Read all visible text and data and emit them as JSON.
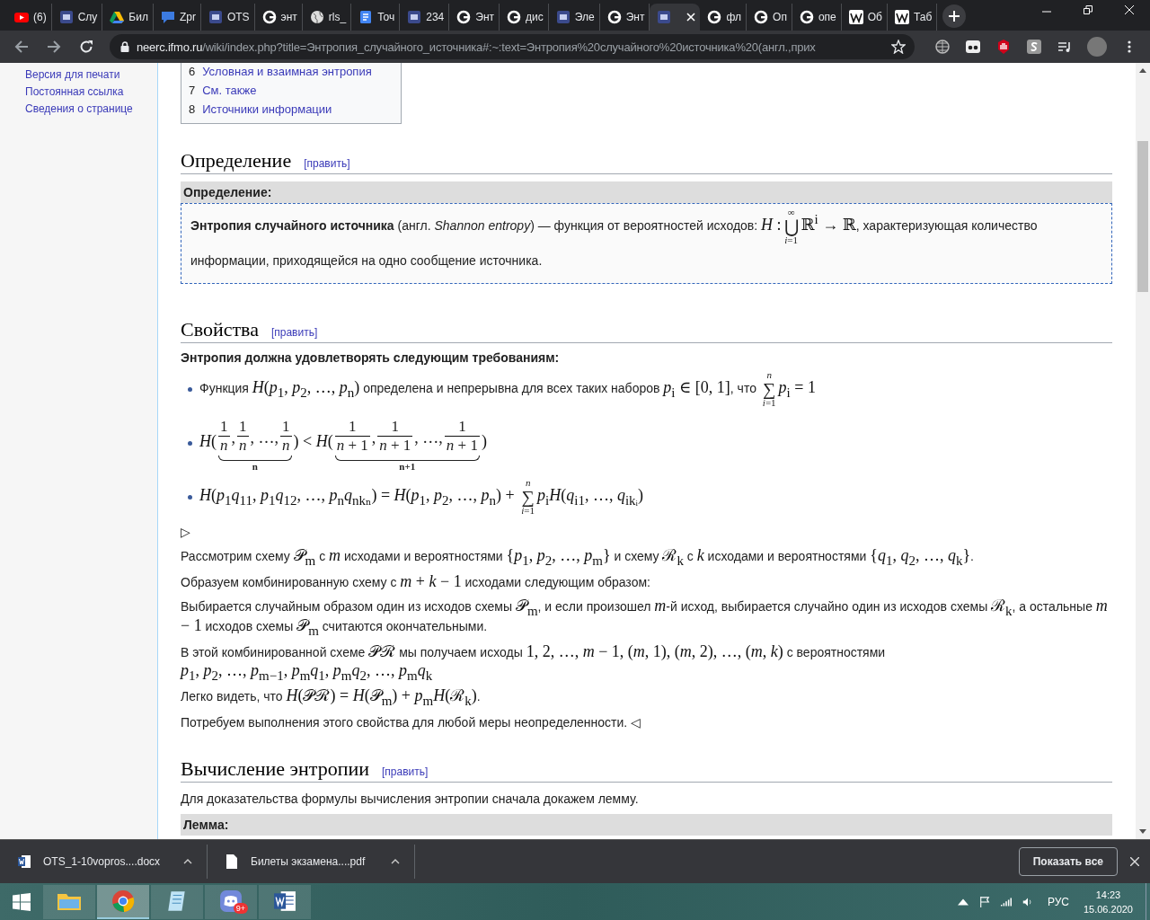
{
  "tabs": [
    {
      "kind": "video",
      "label": "(6)",
      "selected": false
    },
    {
      "kind": "square",
      "label": "Слу",
      "selected": false
    },
    {
      "kind": "drive",
      "label": "Бил",
      "selected": false
    },
    {
      "kind": "chat",
      "label": "Zpr",
      "selected": false
    },
    {
      "kind": "square",
      "label": "OTS",
      "selected": false
    },
    {
      "kind": "search",
      "label": "энт",
      "selected": false
    },
    {
      "kind": "globe",
      "label": "rls_",
      "selected": false
    },
    {
      "kind": "doc",
      "label": "Точ",
      "selected": false
    },
    {
      "kind": "square",
      "label": "234",
      "selected": false
    },
    {
      "kind": "search",
      "label": "Энт",
      "selected": false
    },
    {
      "kind": "search",
      "label": "дис",
      "selected": false
    },
    {
      "kind": "square",
      "label": "Эле",
      "selected": false
    },
    {
      "kind": "search",
      "label": "Энт",
      "selected": false
    },
    {
      "kind": "square",
      "selected": true
    },
    {
      "kind": "search",
      "label": "фл",
      "selected": false
    },
    {
      "kind": "search",
      "label": "Оп",
      "selected": false
    },
    {
      "kind": "search",
      "label": "опе",
      "selected": false
    },
    {
      "kind": "wiki",
      "label": "Об",
      "selected": false
    },
    {
      "kind": "wiki",
      "label": "Таб",
      "selected": false
    }
  ],
  "address": {
    "domain": "neerc.ifmo.ru",
    "path": "/wiki/index.php?title=Энтропия_случайного_источника#:~:text=Энтропия%20случайного%20источника%20(англ.,прих"
  },
  "sidebar": {
    "items": [
      "Версия для печати",
      "Постоянная ссылка",
      "Сведения о странице"
    ]
  },
  "toc": [
    {
      "number": "6",
      "label": "Условная и взаимная энтропия"
    },
    {
      "number": "7",
      "label": "См. также"
    },
    {
      "number": "8",
      "label": "Источники информации"
    }
  ],
  "sections": [
    {
      "title": "Определение",
      "edit": "[править]",
      "blocks": [
        {
          "kind": "boxhead",
          "text": "Определение:"
        },
        {
          "kind": "definition",
          "parts": [
            {
              "kind": "text",
              "text": "**Энтропия случайного источника** (англ. *Shannon entropy*) — функция от вероятностей исходов: "
            },
            {
              "kind": "math",
              "text": "*H* :"
            },
            {
              "kind": "bigop",
              "symbol": "⋃",
              "upper": "∞",
              "lower": "*i*=1"
            },
            {
              "kind": "math",
              "text": "ℝ$^{i}$ → ℝ"
            },
            {
              "kind": "text",
              "text": ", характеризующая количество информации, приходящейся на одно сообщение источника."
            }
          ]
        }
      ]
    },
    {
      "title": "Свойства",
      "edit": "[править]",
      "blocks": [
        {
          "kind": "lead",
          "text": "Энтропия должна удовлетворять следующим требованиям:"
        },
        {
          "kind": "bullets",
          "items": [
            {
              "parts": [
                {
                  "kind": "text",
                  "text": "Функция "
                },
                {
                  "kind": "math",
                  "text": "*H*(*p*$_{1}$, *p*$_{2}$, …, *p*$_{n}$)"
                },
                {
                  "kind": "text",
                  "text": " определена и непрерывна для всех таких наборов "
                },
                {
                  "kind": "math",
                  "text": "*p*$_{i}$ ∈ [0,  1]"
                },
                {
                  "kind": "text",
                  "text": ", что "
                },
                {
                  "kind": "bigop",
                  "symbol": "∑",
                  "upper": "*n*",
                  "lower": "*i*=1"
                },
                {
                  "kind": "math",
                  "text": "*p*$_{i}$ = 1"
                }
              ]
            },
            {
              "parts": [
                {
                  "kind": "math",
                  "text": "*H*("
                },
                {
                  "kind": "brace",
                  "label": "n",
                  "terms": [
                    {
                      "kind": "frac",
                      "num": "1",
                      "den": "*n*",
                      "sep": ","
                    },
                    {
                      "kind": "frac",
                      "num": "1",
                      "den": "*n*",
                      "sep": ", …,"
                    },
                    {
                      "kind": "frac",
                      "num": "1",
                      "den": "*n*"
                    }
                  ]
                },
                {
                  "kind": "math",
                  "text": ") < *H*("
                },
                {
                  "kind": "brace",
                  "label": "n+1",
                  "terms": [
                    {
                      "kind": "frac",
                      "num": "1",
                      "den": "*n* + 1",
                      "sep": ","
                    },
                    {
                      "kind": "frac",
                      "num": "1",
                      "den": "*n* + 1",
                      "sep": ", …,"
                    },
                    {
                      "kind": "frac",
                      "num": "1",
                      "den": "*n* + 1"
                    }
                  ]
                },
                {
                  "kind": "math",
                  "text": ")"
                }
              ]
            },
            {
              "parts": [
                {
                  "kind": "math",
                  "text": "*H*(*p*$_{1}$*q*$_{11}$, *p*$_{1}$*q*$_{12}$, …, *p*$_{n}$*q*$_{nkₙ}$) = *H*(*p*$_{1}$, *p*$_{2}$, …, *p*$_{n}$) + "
                },
                {
                  "kind": "bigop",
                  "symbol": "∑",
                  "upper": "*n*",
                  "lower": "*i*=1"
                },
                {
                  "kind": "math",
                  "text": "*p*$_{i}$*H*(*q*$_{i1}$, …, *q*$_{ikᵢ}$)"
                }
              ]
            }
          ]
        },
        {
          "kind": "para",
          "parts": [
            {
              "kind": "text",
              "text": "▷"
            }
          ]
        },
        {
          "kind": "para",
          "parts": [
            {
              "kind": "text",
              "text": "Рассмотрим схему "
            },
            {
              "kind": "math",
              "text": "𝒫$_{m}$"
            },
            {
              "kind": "text",
              "text": " с "
            },
            {
              "kind": "math",
              "text": "*m*"
            },
            {
              "kind": "text",
              "text": " исходами и вероятностями "
            },
            {
              "kind": "math",
              "text": "{*p*$_{1}$, *p*$_{2}$, …, *p*$_{m}$}"
            },
            {
              "kind": "text",
              "text": " и схему "
            },
            {
              "kind": "math",
              "text": "ℛ$_{k}$"
            },
            {
              "kind": "text",
              "text": " с "
            },
            {
              "kind": "math",
              "text": "*k*"
            },
            {
              "kind": "text",
              "text": " исходами и вероятностями "
            },
            {
              "kind": "math",
              "text": "{*q*$_{1}$, *q*$_{2}$, …, *q*$_{k}$}"
            },
            {
              "kind": "text",
              "text": "."
            }
          ]
        },
        {
          "kind": "para",
          "parts": [
            {
              "kind": "text",
              "text": "Образуем комбинированную схему с "
            },
            {
              "kind": "math",
              "text": "*m* + *k* − 1"
            },
            {
              "kind": "text",
              "text": " исходами следующим образом:"
            }
          ]
        },
        {
          "kind": "para",
          "parts": [
            {
              "kind": "text",
              "text": "Выбирается случайным образом один из исходов схемы "
            },
            {
              "kind": "math",
              "text": "𝒫$_{m}$"
            },
            {
              "kind": "text",
              "text": ", и если произошел "
            },
            {
              "kind": "math",
              "text": "*m*"
            },
            {
              "kind": "text",
              "text": "-й исход, выбирается случайно один из исходов схемы "
            },
            {
              "kind": "math",
              "text": "ℛ$_{k}$"
            },
            {
              "kind": "text",
              "text": ", а остальные "
            },
            {
              "kind": "math",
              "text": "*m* − 1"
            },
            {
              "kind": "text",
              "text": " исходов схемы "
            },
            {
              "kind": "math",
              "text": "𝒫$_{m}$"
            },
            {
              "kind": "text",
              "text": " считаются окончательными."
            }
          ]
        },
        {
          "kind": "para",
          "parts": [
            {
              "kind": "text",
              "text": "В этой комбинированной схеме "
            },
            {
              "kind": "math",
              "text": "𝒫ℛ"
            },
            {
              "kind": "text",
              "text": " мы получаем исходы "
            },
            {
              "kind": "math",
              "text": "1, 2, …, *m* − 1, (*m*, 1), (*m*, 2), …, (*m*, *k*)"
            },
            {
              "kind": "text",
              "text": " с вероятностями"
            },
            {
              "kind": "break"
            },
            {
              "kind": "math",
              "text": "*p*$_{1}$, *p*$_{2}$, …, *p*$_{m−1}$, *p*$_{m}$*q*$_{1}$, *p*$_{m}$*q*$_{2}$, …, *p*$_{m}$*q*$_{k}$"
            }
          ]
        },
        {
          "kind": "para",
          "parts": [
            {
              "kind": "text",
              "text": "Легко видеть, что "
            },
            {
              "kind": "math",
              "text": "*H*(𝒫ℛ) = *H*(𝒫$_{m}$) + *p*$_{m}$*H*(ℛ$_{k}$)"
            },
            {
              "kind": "text",
              "text": "."
            }
          ]
        },
        {
          "kind": "para",
          "parts": [
            {
              "kind": "text",
              "text": "Потребуем выполнения этого свойства для любой меры неопределенности. ◁"
            }
          ]
        }
      ]
    },
    {
      "title": "Вычисление энтропии",
      "edit": "[править]",
      "blocks": [
        {
          "kind": "para",
          "parts": [
            {
              "kind": "text",
              "text": "Для доказательства формулы вычисления энтропии сначала докажем лемму."
            }
          ]
        },
        {
          "kind": "boxhead",
          "text": "Лемма:"
        }
      ]
    }
  ],
  "downloads": [
    {
      "kind": "word",
      "name": "OTS_1-10vopros....docx"
    },
    {
      "kind": "file",
      "name": "Билеты экзамена....pdf"
    }
  ],
  "show_all": "Показать все",
  "taskbar": [
    {
      "kind": "explorer",
      "selected": false
    },
    {
      "kind": "chrome",
      "selected": true
    },
    {
      "kind": "notepad",
      "selected": false
    },
    {
      "kind": "discord",
      "selected": false,
      "badge": "9+"
    },
    {
      "kind": "word",
      "selected": false
    }
  ],
  "tray": {
    "language": "РУС",
    "time": "14:23",
    "date": "15.06.2020"
  }
}
